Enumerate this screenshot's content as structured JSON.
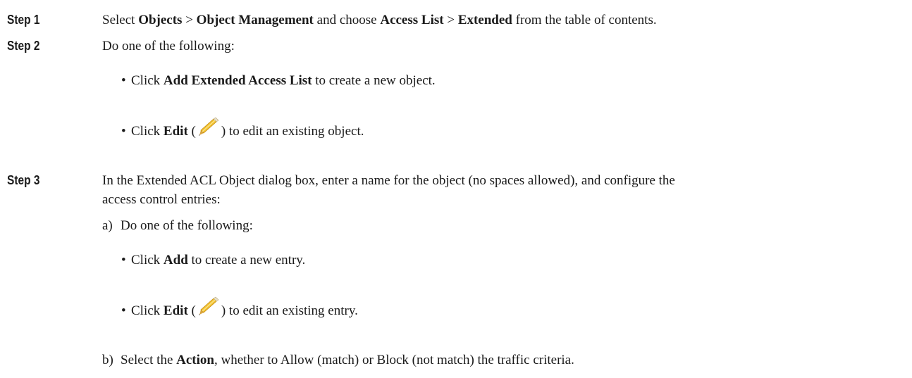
{
  "steps": [
    {
      "label": "Step 1",
      "t1": "Select ",
      "b1": "Objects",
      "t2": " > ",
      "b2": "Object Management",
      "t3": " and choose ",
      "b3": "Access List",
      "t4": " > ",
      "b4": "Extended",
      "t5": " from the table of contents."
    },
    {
      "label": "Step 2",
      "text": "Do one of the following:",
      "bullets": [
        {
          "pre": "Click ",
          "bold": "Add Extended Access List",
          "post": " to create a new object."
        },
        {
          "pre": "Click ",
          "bold": "Edit",
          "open": " (",
          "icon": "pencil-icon",
          "close": ") to edit an existing object."
        }
      ]
    },
    {
      "label": "Step 3",
      "line1": "In the Extended ACL Object dialog box, enter a name for the object (no spaces allowed), and configure the",
      "line2": "access control entries:",
      "substeps": [
        {
          "marker": "a)",
          "text": "Do one of the following:",
          "bullets": [
            {
              "pre": "Click ",
              "bold": "Add",
              "post": " to create a new entry."
            },
            {
              "pre": "Click ",
              "bold": "Edit",
              "open": " (",
              "icon": "pencil-icon",
              "close": ") to edit an existing entry."
            }
          ]
        },
        {
          "marker": "b)",
          "pre": "Select the ",
          "bold": "Action",
          "post": ", whether to Allow (match) or Block (not match) the traffic criteria."
        }
      ]
    }
  ],
  "bullet_char": "•",
  "colors": {
    "text": "#1a1a1a",
    "pencil_body": "#f2c230",
    "pencil_tip": "#d9a441",
    "background": "#ffffff"
  }
}
